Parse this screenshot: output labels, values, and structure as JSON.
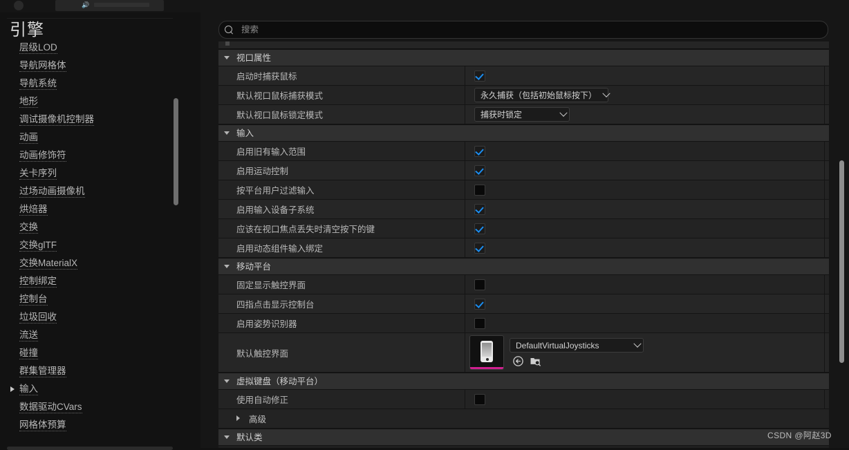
{
  "window": {
    "title": "引擎"
  },
  "sidebar": {
    "title": "引擎",
    "items": [
      {
        "label": "层级LOD",
        "expandable": false
      },
      {
        "label": "导航网格体",
        "expandable": false
      },
      {
        "label": "导航系统",
        "expandable": false
      },
      {
        "label": "地形",
        "expandable": false
      },
      {
        "label": "调试摄像机控制器",
        "expandable": false
      },
      {
        "label": "动画",
        "expandable": false
      },
      {
        "label": "动画修饰符",
        "expandable": false
      },
      {
        "label": "关卡序列",
        "expandable": false
      },
      {
        "label": "过场动画摄像机",
        "expandable": false
      },
      {
        "label": "烘焙器",
        "expandable": false
      },
      {
        "label": "交换",
        "expandable": false
      },
      {
        "label": "交换glTF",
        "expandable": false
      },
      {
        "label": "交换MaterialX",
        "expandable": false
      },
      {
        "label": "控制绑定",
        "expandable": false
      },
      {
        "label": "控制台",
        "expandable": false
      },
      {
        "label": "垃圾回收",
        "expandable": false
      },
      {
        "label": "流送",
        "expandable": false
      },
      {
        "label": "碰撞",
        "expandable": false
      },
      {
        "label": "群集管理器",
        "expandable": false
      },
      {
        "label": "输入",
        "expandable": true
      },
      {
        "label": "数据驱动CVars",
        "expandable": false
      },
      {
        "label": "网格体预算",
        "expandable": false
      }
    ]
  },
  "search": {
    "placeholder": "搜索",
    "value": "",
    "icon": "search-icon"
  },
  "settings_icon": "gear-icon",
  "properties": [
    {
      "kind": "section",
      "label": "视口属性",
      "expanded": true
    },
    {
      "kind": "checkbox",
      "label": "启动时捕获鼠标",
      "checked": true
    },
    {
      "kind": "dropdown",
      "label": "默认视口鼠标捕获模式",
      "value": "永久捕获（包括初始鼠标按下）",
      "width": 192
    },
    {
      "kind": "dropdown",
      "label": "默认视口鼠标锁定模式",
      "value": "捕获时锁定",
      "width": 136
    },
    {
      "kind": "section",
      "label": "输入",
      "expanded": true
    },
    {
      "kind": "checkbox",
      "label": "启用旧有输入范围",
      "checked": true
    },
    {
      "kind": "checkbox",
      "label": "启用运动控制",
      "checked": true
    },
    {
      "kind": "checkbox",
      "label": "按平台用户过滤输入",
      "checked": false
    },
    {
      "kind": "checkbox",
      "label": "启用输入设备子系统",
      "checked": true
    },
    {
      "kind": "checkbox",
      "label": "应该在视口焦点丢失时清空按下的键",
      "checked": true
    },
    {
      "kind": "checkbox",
      "label": "启用动态组件输入绑定",
      "checked": true
    },
    {
      "kind": "section",
      "label": "移动平台",
      "expanded": true
    },
    {
      "kind": "checkbox",
      "label": "固定显示触控界面",
      "checked": false
    },
    {
      "kind": "checkbox",
      "label": "四指点击显示控制台",
      "checked": true
    },
    {
      "kind": "checkbox",
      "label": "启用姿势识别器",
      "checked": false
    },
    {
      "kind": "asset",
      "label": "默认触控界面",
      "value": "DefaultVirtualJoysticks",
      "thumbnail": "mobile-phone-thumbnail",
      "icons": [
        "browse-to-asset-icon",
        "use-selected-asset-icon"
      ]
    },
    {
      "kind": "section",
      "label": "虚拟键盘（移动平台）",
      "expanded": true
    },
    {
      "kind": "checkbox",
      "label": "使用自动修正",
      "checked": false
    },
    {
      "kind": "subsection",
      "label": "高级",
      "expanded": false
    },
    {
      "kind": "section",
      "label": "默认类",
      "expanded": true
    }
  ],
  "watermark": "CSDN @阿赵3D",
  "colors": {
    "accent_checkbox": "#1b8df0",
    "accent_thumbnail_bar": "#cf1f8f",
    "panel_bg": "#1f1f1f",
    "section_bg": "#303030",
    "row_bg": "#232323"
  }
}
